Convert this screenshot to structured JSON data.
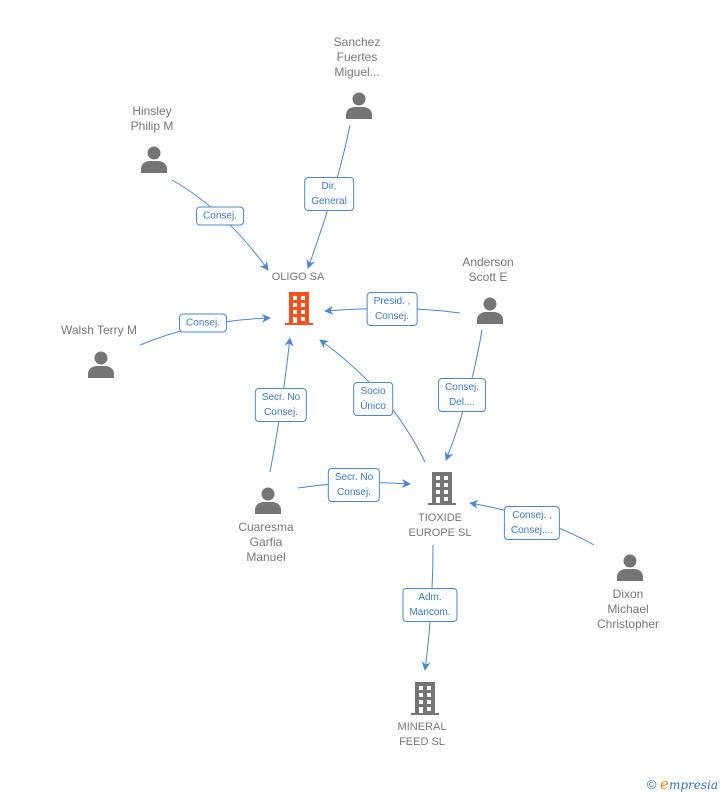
{
  "diagram": {
    "companies": [
      {
        "id": "oligo",
        "name": "OLIGO SA",
        "highlight": true
      },
      {
        "id": "tioxide",
        "name": "TIOXIDE\nEUROPE SL",
        "highlight": false
      },
      {
        "id": "mineral",
        "name": "MINERAL\nFEED SL",
        "highlight": false
      }
    ],
    "persons": [
      {
        "id": "sanchez",
        "name": "Sanchez\nFuertes\nMiguel..."
      },
      {
        "id": "hinsley",
        "name": "Hinsley\nPhilip M"
      },
      {
        "id": "anderson",
        "name": "Anderson\nScott E"
      },
      {
        "id": "walsh",
        "name": "Walsh Terry M"
      },
      {
        "id": "cuaresma",
        "name": "Cuaresma\nGarfia\nManuel"
      },
      {
        "id": "dixon",
        "name": "Dixon\nMichael\nChristopher"
      }
    ],
    "edges": [
      {
        "from": "sanchez",
        "to": "oligo",
        "label": "Dir.\nGeneral"
      },
      {
        "from": "hinsley",
        "to": "oligo",
        "label": "Consej."
      },
      {
        "from": "walsh",
        "to": "oligo",
        "label": "Consej."
      },
      {
        "from": "anderson",
        "to": "oligo",
        "label": "Presid. ,\nConsej."
      },
      {
        "from": "cuaresma",
        "to": "oligo",
        "label": "Secr. No\nConsej."
      },
      {
        "from": "tioxide",
        "to": "oligo",
        "label": "Socio\nÚnico"
      },
      {
        "from": "anderson",
        "to": "tioxide",
        "label": "Consej.\nDel...."
      },
      {
        "from": "cuaresma",
        "to": "tioxide",
        "label": "Secr. No\nConsej."
      },
      {
        "from": "dixon",
        "to": "tioxide",
        "label": "Consej. ,\nConsej...."
      },
      {
        "from": "tioxide",
        "to": "mineral",
        "label": "Adm.\nMancom."
      }
    ],
    "colors": {
      "highlight_company": "#f4511e",
      "company": "#757575",
      "person": "#757575",
      "edge": "#4a87d4",
      "label_text": "#777777"
    }
  },
  "footer": {
    "copyright_symbol": "©",
    "brand_initial": "e",
    "brand_rest": "mpresia"
  }
}
